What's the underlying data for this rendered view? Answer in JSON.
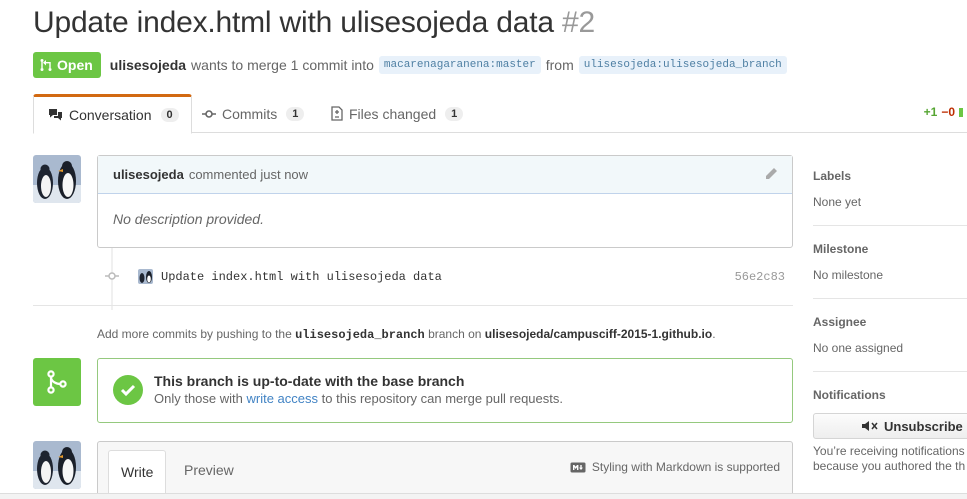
{
  "pull_request": {
    "title": "Update index.html with ulisesojeda data",
    "number": "#2",
    "state": "Open",
    "author": "ulisesojeda",
    "merge_text": "wants to merge 1 commit into",
    "base_ref": "macarenagaranena:master",
    "from_text": "from",
    "head_ref": "ulisesojeda:ulisesojeda_branch"
  },
  "tabs": [
    {
      "label": "Conversation",
      "count": "0",
      "icon": "comment-discussion-icon"
    },
    {
      "label": "Commits",
      "count": "1",
      "icon": "git-commit-icon"
    },
    {
      "label": "Files changed",
      "count": "1",
      "icon": "file-diff-icon"
    }
  ],
  "diffstat": {
    "additions": "+1",
    "deletions": "−0"
  },
  "comment": {
    "author": "ulisesojeda",
    "action": "commented",
    "time": "just now",
    "body": "No description provided."
  },
  "commit": {
    "message": "Update index.html with ulisesojeda data",
    "sha": "56e2c83"
  },
  "hint": {
    "prefix": "Add more commits by pushing to the",
    "branch": "ulisesojeda_branch",
    "middle": "branch on",
    "repo": "ulisesojeda/campusciff-2015-1.github.io",
    "suffix": "."
  },
  "merge": {
    "title": "This branch is up-to-date with the base branch",
    "desc_prefix": "Only those with",
    "desc_link": "write access",
    "desc_suffix": "to this repository can merge pull requests."
  },
  "editor": {
    "write_tab": "Write",
    "preview_tab": "Preview",
    "markdown_hint": "Styling with Markdown is supported"
  },
  "sidebar": {
    "labels_title": "Labels",
    "labels_value": "None yet",
    "milestone_title": "Milestone",
    "milestone_value": "No milestone",
    "assignee_title": "Assignee",
    "assignee_value": "No one assigned",
    "notifications_title": "Notifications",
    "unsubscribe_label": "Unsubscribe",
    "notif_line1": "You’re receiving notifications",
    "notif_line2": "because you authored the th"
  },
  "colors": {
    "open_green": "#6cc644",
    "link_blue": "#4183c4",
    "tab_accent": "#d26911"
  }
}
